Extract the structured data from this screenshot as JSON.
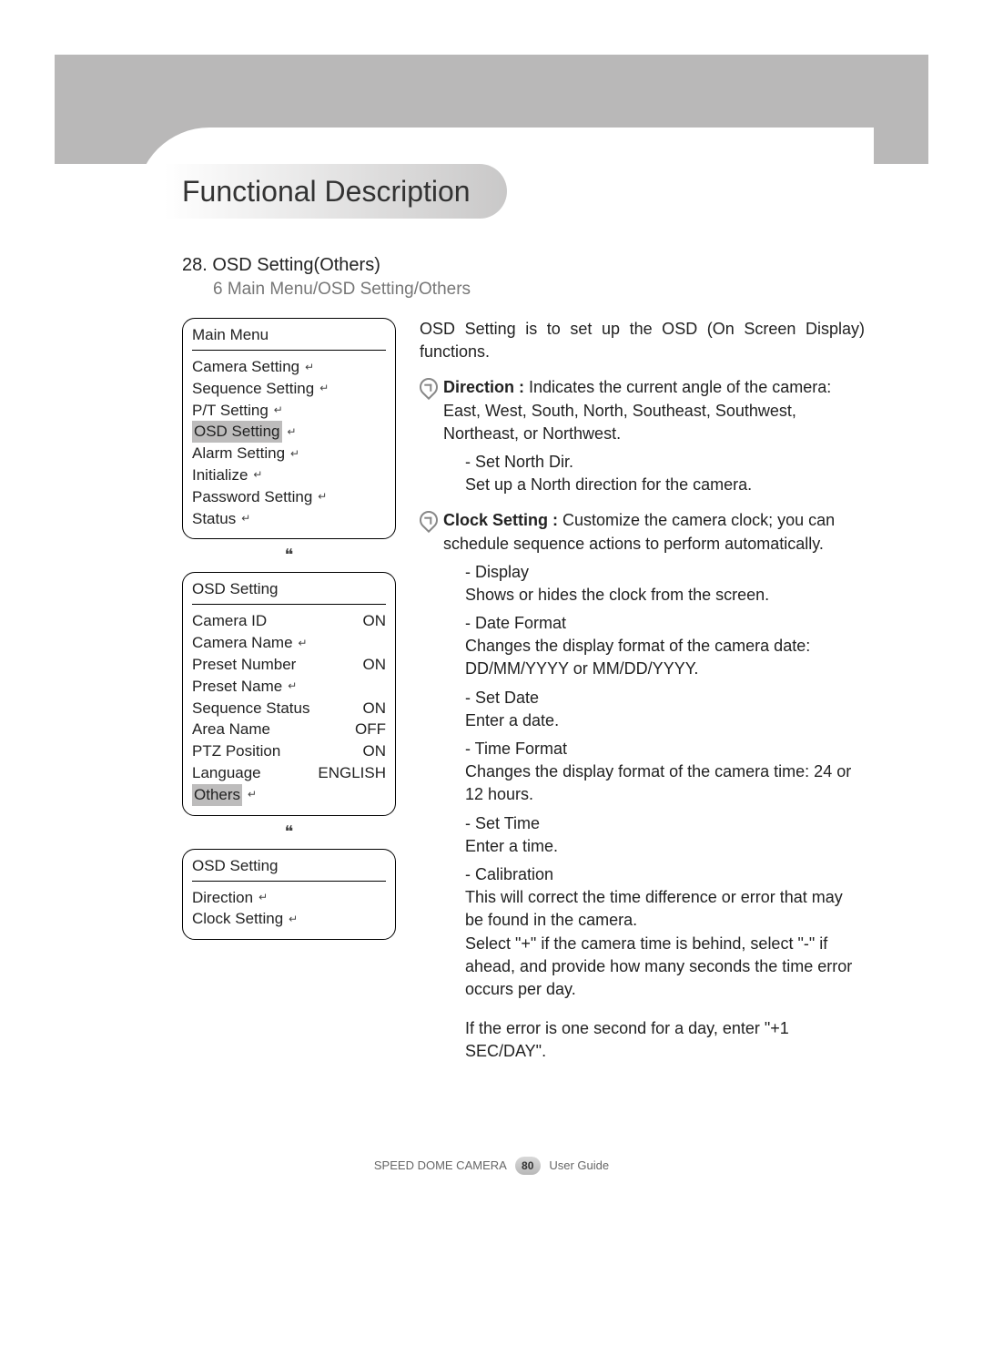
{
  "heading": "Functional Description",
  "section": {
    "number": "28.",
    "title": "OSD Setting(Others)",
    "breadcrumb_prefix": "6",
    "breadcrumb": "Main Menu/OSD Setting/Others"
  },
  "menus": {
    "main": {
      "title": "Main Menu",
      "items": [
        {
          "label": "Camera Setting",
          "icon": "sub"
        },
        {
          "label": "Sequence Setting",
          "icon": "sub"
        },
        {
          "label": "P/T Setting",
          "icon": "sub"
        },
        {
          "label": "OSD Setting",
          "icon": "enter",
          "highlight": true
        },
        {
          "label": "Alarm Setting",
          "icon": "sub"
        },
        {
          "label": "Initialize",
          "icon": "sub"
        },
        {
          "label": "Password Setting",
          "icon": "sub"
        },
        {
          "label": "Status",
          "icon": "sub"
        }
      ]
    },
    "osd1": {
      "title": "OSD Setting",
      "items": [
        {
          "label": "Camera ID",
          "value": "ON"
        },
        {
          "label": "Camera Name",
          "icon": "sub"
        },
        {
          "label": "Preset Number",
          "value": "ON"
        },
        {
          "label": "Preset Name",
          "icon": "sub"
        },
        {
          "label": "Sequence Status",
          "value": "ON"
        },
        {
          "label": "Area Name",
          "value": "OFF"
        },
        {
          "label": "PTZ Position",
          "value": "ON"
        },
        {
          "label": "Language",
          "value": "ENGLISH"
        },
        {
          "label": "Others",
          "icon": "enter",
          "highlight": true
        }
      ]
    },
    "osd2": {
      "title": "OSD Setting",
      "items": [
        {
          "label": "Direction",
          "icon": "sub"
        },
        {
          "label": "Clock Setting",
          "icon": "sub"
        }
      ]
    }
  },
  "desc": {
    "intro": "OSD Setting is to set up the OSD (On Screen Display) functions.",
    "direction": {
      "label": "Direction :",
      "text": "Indicates the current angle of the camera: East, West, South, North, Southeast, Southwest, Northeast, or Northwest.",
      "sub_label": "- Set North Dir.",
      "sub_text": "Set up a North direction for the camera."
    },
    "clock": {
      "label": "Clock Setting :",
      "text": "Customize the camera clock; you can schedule sequence actions to perform automatically.",
      "subs": [
        {
          "label": "- Display",
          "text": "Shows or hides the clock from the screen."
        },
        {
          "label": "- Date Format",
          "text": "Changes the display format of the camera date: DD/MM/YYYY or MM/DD/YYYY."
        },
        {
          "label": "- Set Date",
          "text": "Enter a date."
        },
        {
          "label": "- Time Format",
          "text": "Changes the display format of the camera time: 24 or 12 hours."
        },
        {
          "label": "- Set Time",
          "text": "Enter a time."
        },
        {
          "label": "- Calibration",
          "text": "This will correct the time difference or error that may be found in the camera.\nSelect \"+\" if the camera time is behind, select \"-\" if ahead, and provide how many seconds the time error occurs per day."
        }
      ],
      "note": "If the error is one second for a day, enter \"+1 SEC/DAY\"."
    }
  },
  "footer": {
    "left": "SPEED DOME CAMERA",
    "page": "80",
    "right": "User Guide"
  }
}
